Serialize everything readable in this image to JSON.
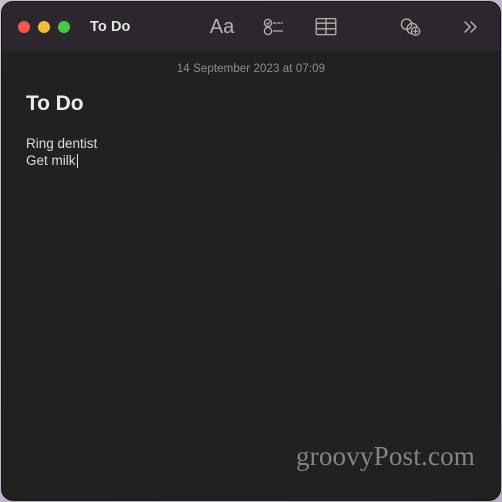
{
  "window": {
    "title": "To Do",
    "traffic_lights": [
      {
        "name": "close",
        "color": "#f4574f"
      },
      {
        "name": "minimize",
        "color": "#f5bb3e"
      },
      {
        "name": "maximize",
        "color": "#46c94a"
      }
    ],
    "background_color": "#212121",
    "toolbar_color": "#2b272c"
  },
  "toolbar": {
    "format_label": "Aa",
    "format_name": "format-text",
    "checklist_name": "checklist",
    "table_name": "table",
    "share_name": "add-people",
    "more_name": "more-options",
    "more_glyph": "»"
  },
  "note": {
    "date": "14 September 2023 at 07:09",
    "title": "To Do",
    "lines": [
      "Ring dentist",
      "Get milk"
    ],
    "cursor_after_line_index": 1
  },
  "watermark": {
    "text": "groovyPost.com"
  }
}
